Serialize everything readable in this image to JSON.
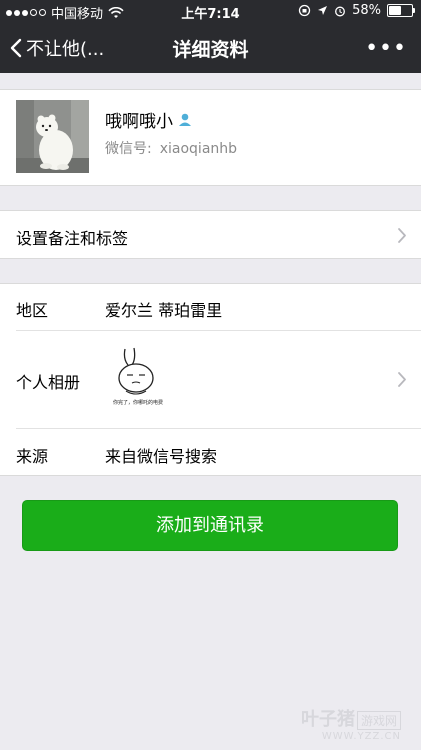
{
  "status_bar": {
    "carrier": "中国移动",
    "time": "上午7:14",
    "battery": "58%",
    "battery_level": 0.58,
    "signal_bars_filled": 3,
    "signal_bars_total": 5
  },
  "nav": {
    "back_label": "不让他(...",
    "title": "详细资料",
    "more_label": "•••"
  },
  "profile": {
    "name": "哦啊哦小",
    "wechat_id_label": "微信号:",
    "wechat_id": "xiaoqianhb"
  },
  "remark_row": {
    "label": "设置备注和标签"
  },
  "info": {
    "region_label": "地区",
    "region_value": "爱尔兰 蒂珀雷里",
    "album_label": "个人相册",
    "album_caption": "你完了，你哪吒的电费",
    "source_label": "来源",
    "source_value": "来自微信号搜索"
  },
  "actions": {
    "add_contact_label": "添加到通讯录"
  },
  "watermark": {
    "brand": "叶子猪",
    "badge": "游戏网",
    "url": "WWW.YZZ.CN"
  },
  "colors": {
    "nav_bg": "#2A2B2F",
    "page_bg": "#ECEBF0",
    "primary_green": "#1AAD19",
    "icon_blue": "#4FAFD8"
  }
}
